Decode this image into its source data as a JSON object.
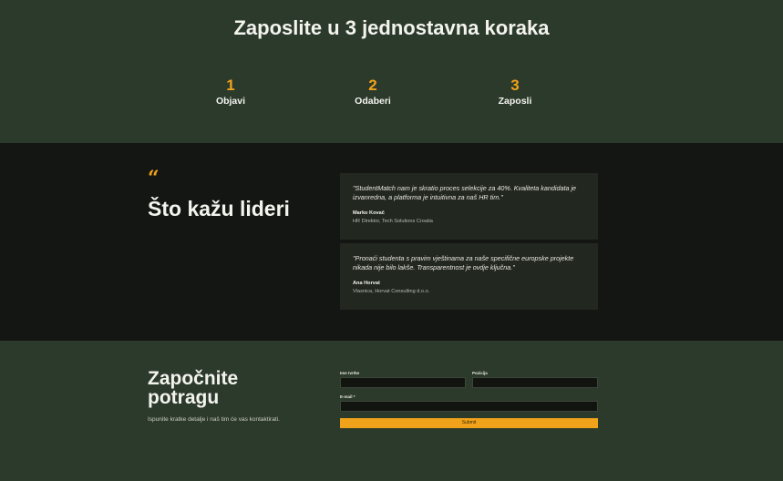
{
  "steps": {
    "title": "Zaposlite u 3 jednostavna koraka",
    "items": [
      {
        "number": "1",
        "label": "Objavi"
      },
      {
        "number": "2",
        "label": "Odaberi"
      },
      {
        "number": "3",
        "label": "Zaposli"
      }
    ]
  },
  "testimonials": {
    "quote_mark": "“",
    "heading": "Što kažu lideri",
    "items": [
      {
        "quote": "\"StudentMatch nam je skratio proces selekcije za 40%. Kvaliteta kandidata je izvanredna, a platforma je intuitivna za naš HR tim.\"",
        "name": "Marko Kovač",
        "role": "HR Direktor, Tech Solutions Croatia"
      },
      {
        "quote": "\"Pronaći studenta s pravim vještinama za naše specifične europske projekte nikada nije bilo lakše. Transparentnost je ovdje ključna.\"",
        "name": "Ana Horvat",
        "role": "Vlasnica, Horvat Consulting d.o.o."
      }
    ]
  },
  "contact": {
    "title": "Započnite potragu",
    "subtitle": "Ispunite kratke detalje i naš tim će vas kontaktirati.",
    "fields": {
      "name_label": "Ime tvrtke",
      "position_label": "Pozicija",
      "email_label": "E-mail *"
    },
    "submit_label": "Submit"
  },
  "colors": {
    "accent": "#f0a21b",
    "green_bg": "#2c3a2b",
    "dark_bg": "#141613",
    "card_bg": "#22271f"
  }
}
